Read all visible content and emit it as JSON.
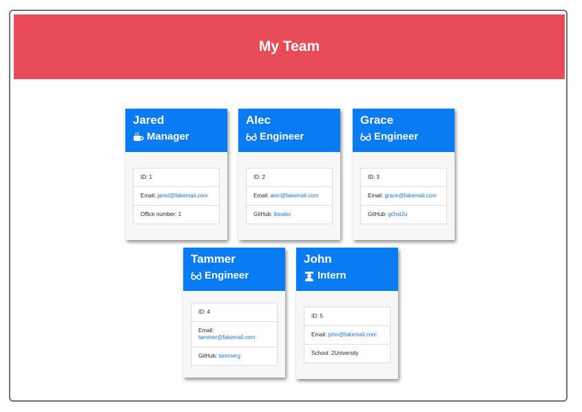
{
  "header": {
    "title": "My Team"
  },
  "labels": {
    "id_prefix": "ID:",
    "email_prefix": "Email:",
    "github_prefix": "GitHub:",
    "office_prefix": "Office number:",
    "school_prefix": "School:"
  },
  "employees": [
    {
      "name": "Jared",
      "role": "Manager",
      "icon": "mug-icon",
      "id": "1",
      "email": "jared@fakemail.com",
      "extra_label": "Office number:",
      "extra_value": "1"
    },
    {
      "name": "Alec",
      "role": "Engineer",
      "icon": "glasses-icon",
      "id": "2",
      "email": "alec@fakemail.com",
      "extra_label": "GitHub:",
      "extra_value": "ibealec"
    },
    {
      "name": "Grace",
      "role": "Engineer",
      "icon": "glasses-icon",
      "id": "3",
      "email": "grace@fakemail.com",
      "extra_label": "GitHub:",
      "extra_value": "gchoi2u"
    },
    {
      "name": "Tammer",
      "role": "Engineer",
      "icon": "glasses-icon",
      "id": "4",
      "email": "tammer@fakemail.com",
      "extra_label": "GitHub:",
      "extra_value": "tammerg"
    },
    {
      "name": "John",
      "role": "Intern",
      "icon": "graduate-icon",
      "id": "5",
      "email": "john@fakemail.com",
      "extra_label": "School:",
      "extra_value": "2University"
    }
  ],
  "colors": {
    "header_bg": "#e84c59",
    "card_header_bg": "#0a7cf3",
    "link": "#1a73e8"
  }
}
